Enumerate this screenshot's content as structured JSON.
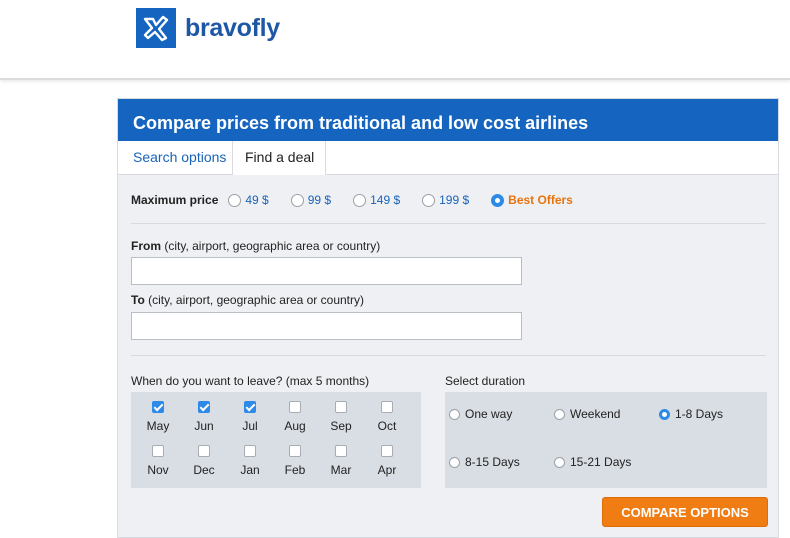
{
  "brand": {
    "name": "bravofly",
    "color": "#1565c0"
  },
  "panel": {
    "title": "Compare prices from traditional and low cost airlines"
  },
  "tabs": [
    {
      "label": "Search options",
      "active": false
    },
    {
      "label": "Find a deal",
      "active": true
    }
  ],
  "price": {
    "label": "Maximum price",
    "options": [
      {
        "label": "49 $",
        "selected": false
      },
      {
        "label": "99 $",
        "selected": false
      },
      {
        "label": "149 $",
        "selected": false
      },
      {
        "label": "199 $",
        "selected": false
      },
      {
        "label": "Best Offers",
        "selected": true
      }
    ]
  },
  "from": {
    "label_bold": "From",
    "label_rest": " (city, airport, geographic area or country)",
    "value": ""
  },
  "to": {
    "label_bold": "To",
    "label_rest": " (city, airport, geographic area or country)",
    "value": ""
  },
  "months": {
    "label": "When do you want to leave? (max 5 months)",
    "items": [
      {
        "label": "May",
        "checked": true
      },
      {
        "label": "Jun",
        "checked": true
      },
      {
        "label": "Jul",
        "checked": true
      },
      {
        "label": "Aug",
        "checked": false
      },
      {
        "label": "Sep",
        "checked": false
      },
      {
        "label": "Oct",
        "checked": false
      },
      {
        "label": "Nov",
        "checked": false
      },
      {
        "label": "Dec",
        "checked": false
      },
      {
        "label": "Jan",
        "checked": false
      },
      {
        "label": "Feb",
        "checked": false
      },
      {
        "label": "Mar",
        "checked": false
      },
      {
        "label": "Apr",
        "checked": false
      }
    ]
  },
  "duration": {
    "label": "Select duration",
    "options": [
      {
        "label": "One way",
        "selected": false
      },
      {
        "label": "Weekend",
        "selected": false
      },
      {
        "label": "1-8 Days",
        "selected": true
      },
      {
        "label": "8-15 Days",
        "selected": false
      },
      {
        "label": "15-21 Days",
        "selected": false
      }
    ]
  },
  "cta": {
    "label": "COMPARE OPTIONS",
    "color": "#f07d14"
  }
}
